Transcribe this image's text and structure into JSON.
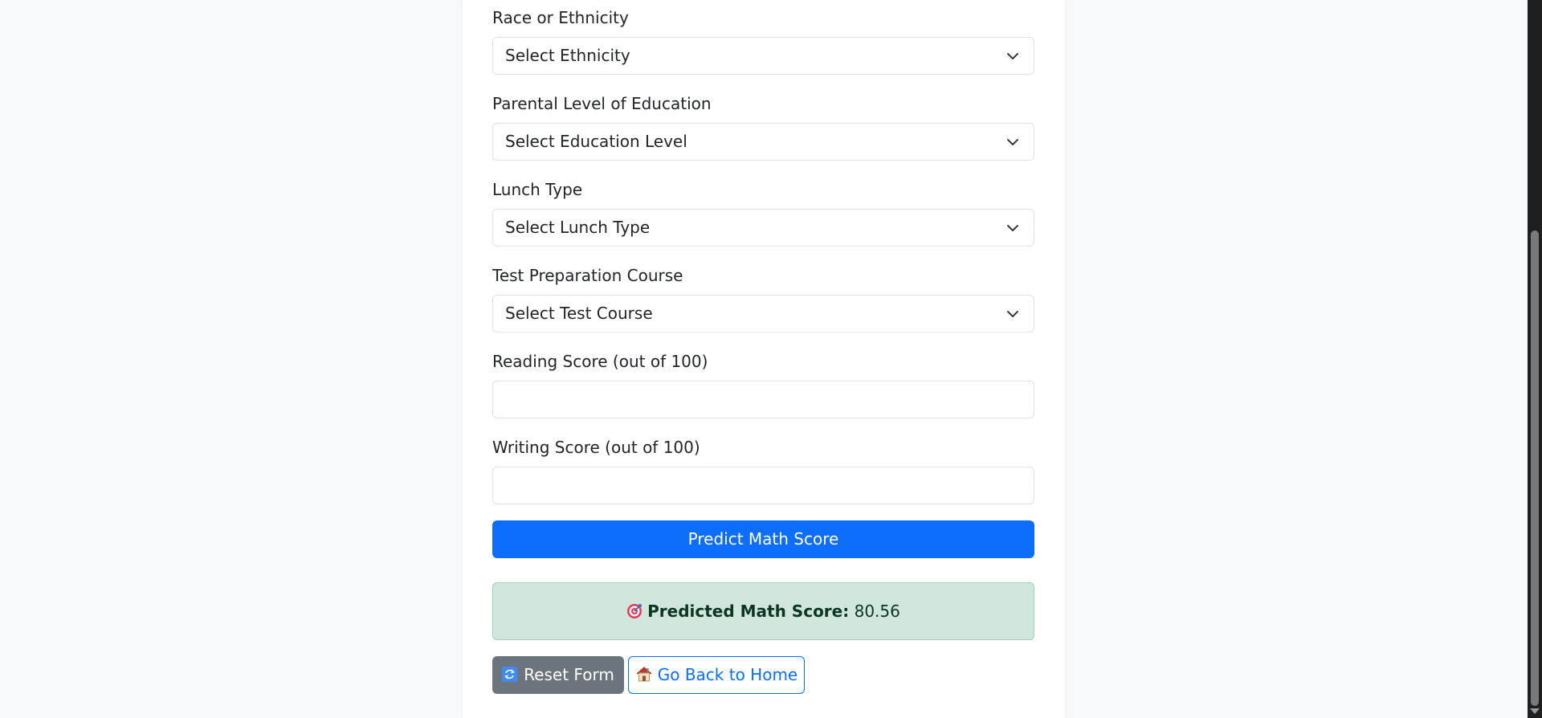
{
  "form": {
    "ethnicity": {
      "label": "Race or Ethnicity",
      "selected": "Select Ethnicity"
    },
    "education": {
      "label": "Parental Level of Education",
      "selected": "Select Education Level"
    },
    "lunch": {
      "label": "Lunch Type",
      "selected": "Select Lunch Type"
    },
    "test_course": {
      "label": "Test Preparation Course",
      "selected": "Select Test Course"
    },
    "reading": {
      "label": "Reading Score (out of 100)",
      "value": ""
    },
    "writing": {
      "label": "Writing Score (out of 100)",
      "value": ""
    },
    "submit_label": "Predict Math Score"
  },
  "result": {
    "label": "Predicted Math Score:",
    "value": "80.56"
  },
  "actions": {
    "reset_label": "Reset Form",
    "home_label": "Go Back to Home"
  },
  "colors": {
    "primary": "#0d6efd",
    "secondary": "#6c757d",
    "success_bg": "#d1e7dd"
  }
}
